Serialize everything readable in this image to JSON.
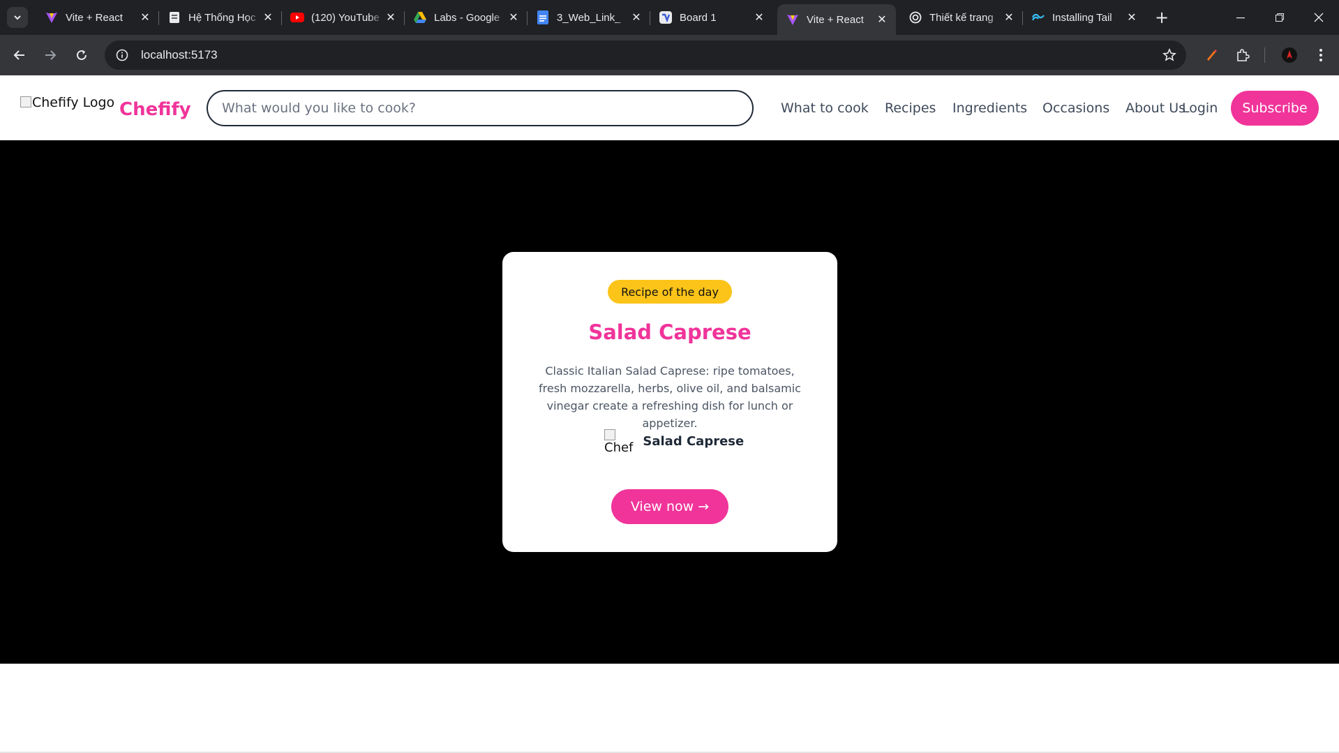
{
  "browser": {
    "tabs": [
      {
        "title": "Vite + React",
        "icon": "vite-icon",
        "active": false
      },
      {
        "title": "Hệ Thống Học",
        "icon": "document-icon",
        "active": false
      },
      {
        "title": "(120) YouTube",
        "icon": "youtube-icon",
        "active": false
      },
      {
        "title": "Labs - Google",
        "icon": "google-drive-icon",
        "active": false
      },
      {
        "title": "3_Web_Link_",
        "icon": "google-docs-icon",
        "active": false
      },
      {
        "title": "Board 1",
        "icon": "board-icon",
        "active": false
      },
      {
        "title": "Vite + React",
        "icon": "vite-icon",
        "active": true
      },
      {
        "title": "Thiết kế trang",
        "icon": "openai-icon",
        "active": false
      },
      {
        "title": "Installing Tail",
        "icon": "tailwind-icon",
        "active": false
      }
    ],
    "url": "localhost:5173",
    "colors": {
      "chrome_dark": "#202124",
      "chrome_mid": "#35363a"
    }
  },
  "header": {
    "logo_alt": "Chefify Logo",
    "brand": "Chefify",
    "search_placeholder": "What would you like to cook?",
    "nav": [
      "What to cook",
      "Recipes",
      "Ingredients",
      "Occasions",
      "About Us"
    ],
    "login": "Login",
    "subscribe": "Subscribe"
  },
  "hero": {
    "badge": "Recipe of the day",
    "title": "Salad Caprese",
    "description": "Classic Italian Salad Caprese: ripe tomatoes, fresh mozzarella, herbs, olive oil, and balsamic vinegar create a refreshing dish for lunch or appetizer.",
    "author_img_alt": "Chef",
    "author_name": "Salad Caprese",
    "cta": "View now →"
  },
  "colors": {
    "accent": "#f0349a",
    "badge": "#fcc419",
    "hero_bg": "#000000"
  }
}
